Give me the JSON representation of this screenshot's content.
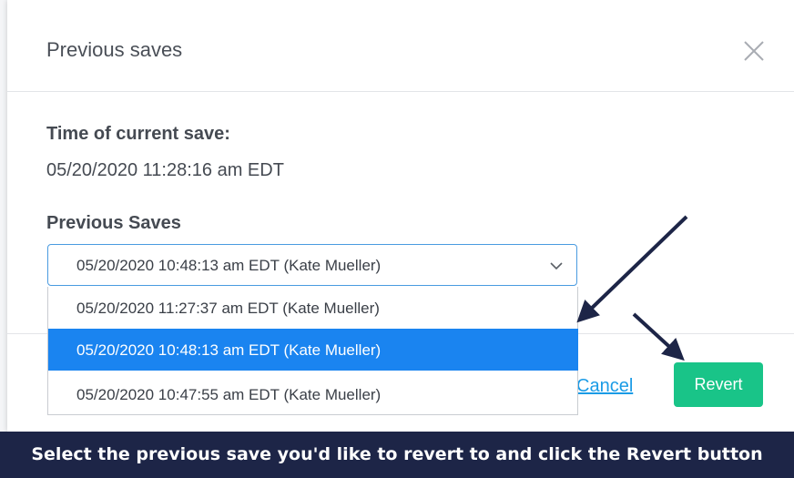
{
  "modal": {
    "title": "Previous saves",
    "close_icon": "close-icon"
  },
  "current_save": {
    "label": "Time of current save:",
    "value": "05/20/2020 11:28:16 am EDT"
  },
  "previous_saves": {
    "label": "Previous Saves",
    "selected": "05/20/2020 10:48:13 am EDT (Kate Mueller)",
    "options": [
      "05/20/2020 11:27:37 am EDT (Kate Mueller)",
      "05/20/2020 10:48:13 am EDT (Kate Mueller)",
      "05/20/2020 10:47:55 am EDT (Kate Mueller)"
    ],
    "highlighted_index": 1
  },
  "footer": {
    "cancel_label": "Cancel",
    "revert_label": "Revert"
  },
  "banner": {
    "text": "Select the previous save you'd like to revert to and click the Revert button"
  },
  "colors": {
    "accent": "#1a84f0",
    "revert": "#19c488",
    "banner": "#1d2547",
    "arrow": "#1d2547"
  }
}
